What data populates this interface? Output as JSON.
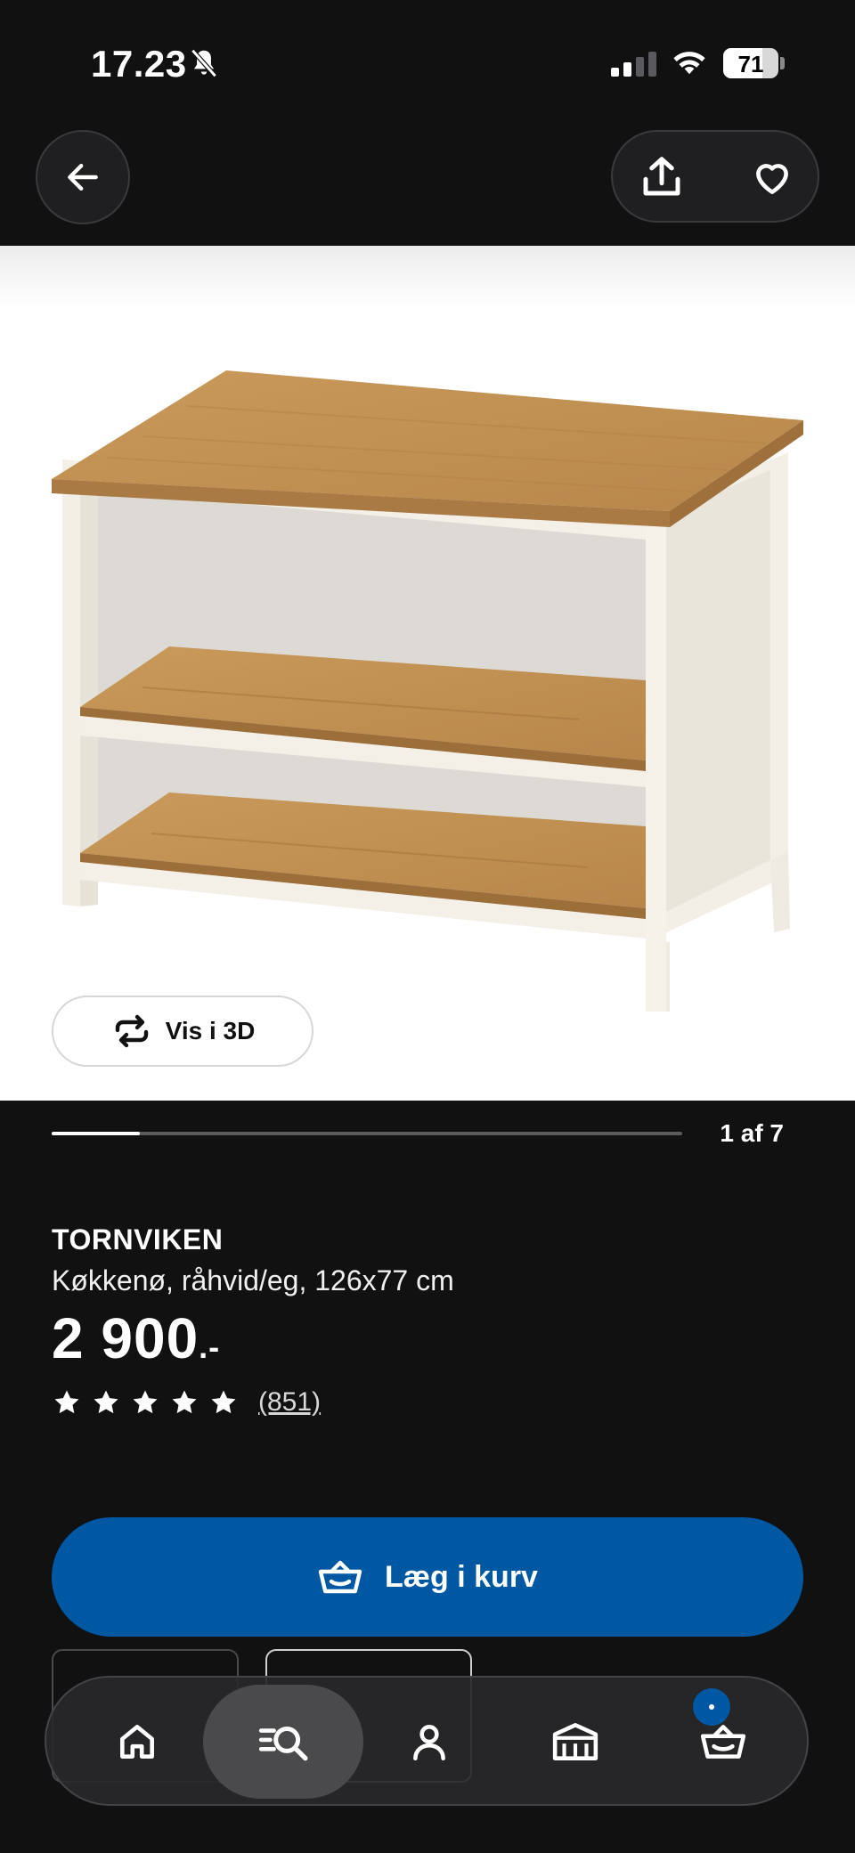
{
  "status_bar": {
    "time": "17.23",
    "battery": "71",
    "icons": [
      "bell-muted-icon",
      "signal-icon",
      "wifi-icon",
      "battery-icon"
    ]
  },
  "nav": {
    "icons": [
      "arrow-left-icon",
      "share-icon",
      "heart-icon"
    ]
  },
  "gallery": {
    "view_3d_label": "Vis i 3D",
    "counter": "1 af 7",
    "progress_fraction": 0.14
  },
  "product": {
    "name": "TORNVIKEN",
    "description": "Køkkenø, råhvid/eg, 126x77 cm",
    "price": "2 900",
    "price_suffix": ".-",
    "rating_stars": 5,
    "review_count": "(851)"
  },
  "actions": {
    "add_to_cart_label": "Læg i kurv"
  },
  "tabbar": {
    "items": [
      "home-icon",
      "search-list-icon",
      "account-icon",
      "store-icon",
      "cart-icon"
    ],
    "active_index": 1
  },
  "colors": {
    "background": "#111112",
    "accent": "#0058a3"
  }
}
